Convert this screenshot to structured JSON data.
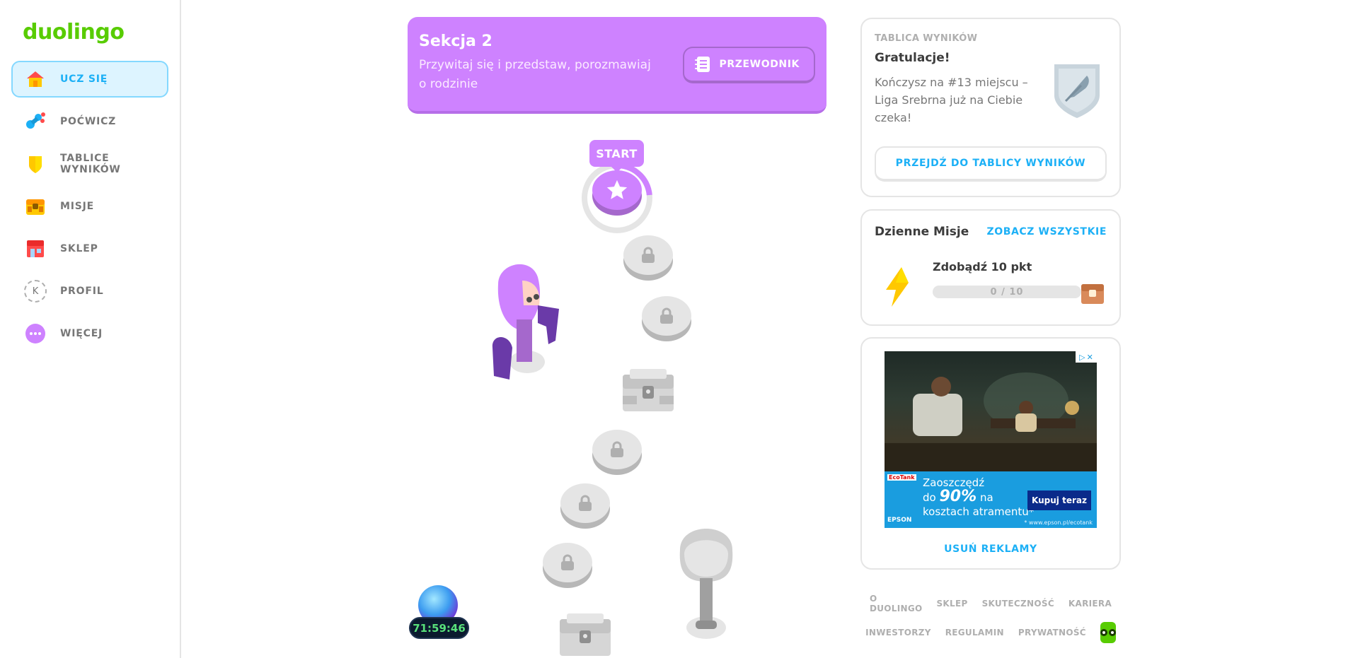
{
  "brand": {
    "logo_text": "duolingo",
    "color": "#58cc02"
  },
  "sidebar": {
    "items": [
      {
        "label": "UCZ SIĘ",
        "icon": "home-icon",
        "active": true
      },
      {
        "label": "POĆWICZ",
        "icon": "dumbbell-icon",
        "active": false
      },
      {
        "label": "TABLICE WYNIKÓW",
        "icon": "shield-icon",
        "active": false
      },
      {
        "label": "MISJE",
        "icon": "chest-icon",
        "active": false
      },
      {
        "label": "SKLEP",
        "icon": "shop-icon",
        "active": false
      },
      {
        "label": "PROFIL",
        "icon": "profile-avatar-icon",
        "avatar_letter": "K",
        "active": false
      },
      {
        "label": "WIĘCEJ",
        "icon": "more-icon",
        "active": false
      }
    ]
  },
  "section": {
    "title": "Sekcja 2",
    "description": "Przywitaj się i przedstaw, porozmawiaj o rodzinie",
    "guide_label": "PRZEWODNIK",
    "color": "#ce82ff"
  },
  "path": {
    "start_label": "START",
    "nodes": [
      {
        "type": "lesson",
        "state": "current"
      },
      {
        "type": "lesson",
        "state": "locked"
      },
      {
        "type": "lesson",
        "state": "locked"
      },
      {
        "type": "chest",
        "state": "locked"
      },
      {
        "type": "lesson",
        "state": "locked"
      },
      {
        "type": "lesson",
        "state": "locked"
      },
      {
        "type": "lesson",
        "state": "locked"
      },
      {
        "type": "chest",
        "state": "locked"
      }
    ]
  },
  "timer": {
    "value": "71:59:46"
  },
  "leaderboard": {
    "label": "TABLICA WYNIKÓW",
    "title": "Gratulacje!",
    "text": "Kończysz na #13 miejscu – Liga Srebrna już na Ciebie czeka!",
    "button": "PRZEJDŹ DO TABLICY WYNIKÓW"
  },
  "quests": {
    "title": "Dzienne Misje",
    "link": "ZOBACZ WSZYSTKIE",
    "items": [
      {
        "name": "Zdobądź 10 pkt",
        "progress_text": "0 / 10",
        "progress": 0,
        "icon": "lightning-icon"
      }
    ]
  },
  "ad": {
    "headline_prefix": "Zaoszczędź",
    "headline_do": "do",
    "headline_percent": "90%",
    "headline_na": "na",
    "headline_suffix": "kosztach atramentu*",
    "button": "Kupuj teraz",
    "brand": "EPSON",
    "small_logo": "EcoTank",
    "url": "* www.epson.pl/ecotank",
    "remove_label": "USUŃ REKLAMY"
  },
  "footer": {
    "row1": [
      "O DUOLINGO",
      "SKLEP",
      "SKUTECZNOŚĆ",
      "KARIERA"
    ],
    "row2": [
      "INWESTORZY",
      "REGULAMIN",
      "PRYWATNOŚĆ"
    ]
  }
}
